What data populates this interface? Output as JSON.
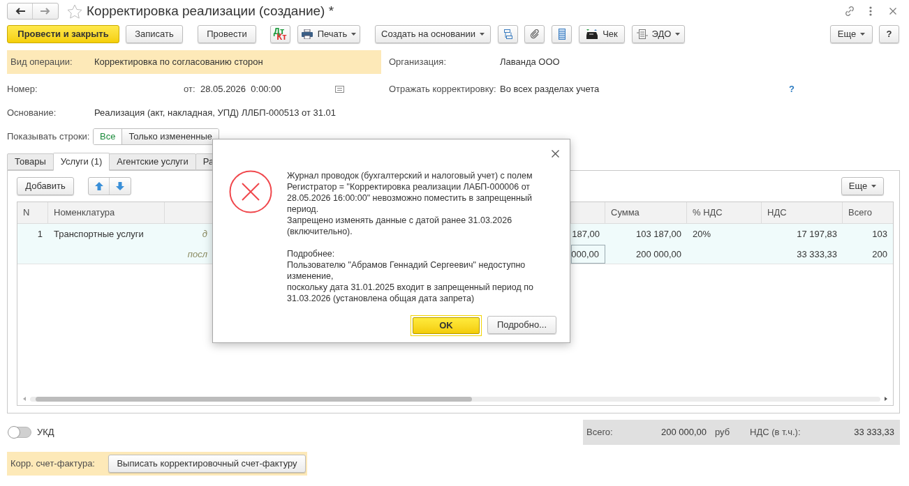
{
  "window": {
    "title": "Корректировка реализации (создание) *"
  },
  "toolbar": {
    "post_close": "Провести и закрыть",
    "write": "Записать",
    "post": "Провести",
    "dtkt": {
      "top": "Дт",
      "bottom": "Кт"
    },
    "print": "Печать",
    "create_based": "Создать на основании",
    "check": "Чек",
    "edo": "ЭДО",
    "more": "Еще",
    "help": "?"
  },
  "form": {
    "operation_type": {
      "label": "Вид операции:",
      "value": "Корректировка по согласованию сторон"
    },
    "organization": {
      "label": "Организация:",
      "value": "Лаванда ООО"
    },
    "number": {
      "label": "Номер:"
    },
    "date": {
      "label": "от:",
      "value": "28.05.2026  0:00:00"
    },
    "reflect": {
      "label": "Отражать корректировку:",
      "value": "Во всех разделах учета",
      "help": "?"
    },
    "basis": {
      "label": "Основание:",
      "value": "Реализация (акт, накладная, УПД) ЛЛБП-000513 от 31.01"
    },
    "show_rows": {
      "label": "Показывать строки:",
      "options": [
        {
          "label": "Все",
          "selected": true
        },
        {
          "label": "Только измененные",
          "selected": false
        }
      ]
    }
  },
  "tabs": [
    {
      "label": "Товары",
      "selected": false
    },
    {
      "label": "Услуги (1)",
      "selected": true
    },
    {
      "label": "Агентские услуги",
      "selected": false
    },
    {
      "label": "Ра",
      "selected": false
    }
  ],
  "table": {
    "add_button": "Добавить",
    "more_button": "Еще",
    "columns": {
      "n": "N",
      "name": "Номенклатура",
      "sum": "Сумма",
      "vat_rate": "% НДС",
      "vat": "НДС",
      "total": "Всего"
    },
    "rows": [
      {
        "selected": true,
        "editing": false,
        "n": "1",
        "name": "Транспортные услуги",
        "column_3": "д",
        "column_5": "187,00",
        "sum": "103 187,00",
        "vat_rate": "20%",
        "vat": "17 197,83",
        "total": "103"
      },
      {
        "selected": true,
        "editing": true,
        "column_3": "посл",
        "column_5": "000,00",
        "sum": "200 000,00",
        "vat": "33 333,33",
        "total": "200"
      }
    ]
  },
  "ukd": {
    "label": "УКД",
    "on": false
  },
  "totals": {
    "total_label": "Всего:",
    "total": "200 000,00",
    "currency": "руб",
    "vat_label": "НДС (в т.ч.):",
    "vat": "33 333,33"
  },
  "invoice": {
    "label": "Корр. счет-фактура:",
    "button": "Выписать корректировочный счет-фактуру"
  },
  "dialog": {
    "paragraphs": [
      "Журнал проводок (бухгалтерский и налоговый учет) с полем\nРегистратор = \"Корректировка реализации ЛАБП-000006 от\n28.05.2026 16:00:00\" невозможно поместить в запрещенный\nпериод.",
      "Запрещено изменять данные с датой ранее 31.03.2026\n(включительно).",
      "Подробнее:\nПользователю \"Абрамов Геннадий Сергеевич\" недоступно\nизменение,\nпоскольку дата 31.01.2025 входит в запрещенный период по\n31.03.2026 (установлена общая дата запрета)"
    ],
    "buttons": [
      {
        "label": "OK",
        "default": true
      },
      {
        "label": "Подробно...",
        "default": false
      }
    ]
  }
}
